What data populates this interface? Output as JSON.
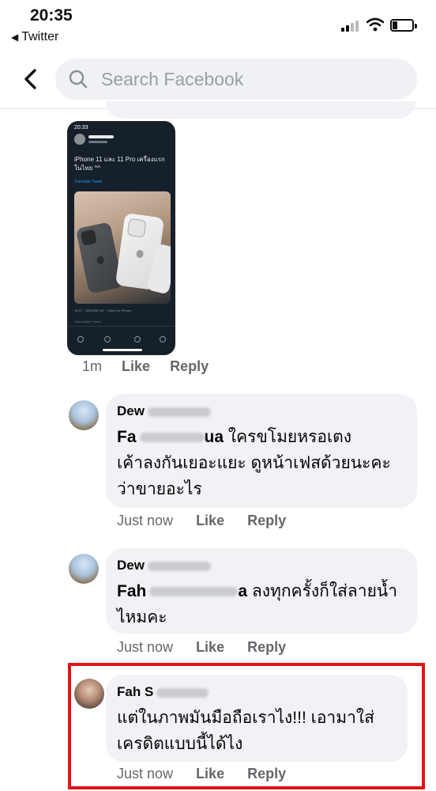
{
  "status_bar": {
    "time": "20:35",
    "back_app": "Twitter"
  },
  "header": {
    "search_placeholder": "Search Facebook"
  },
  "attachment": {
    "time": "20:33",
    "tweet_text": "iPhone 11 และ 11 Pro เครื่องแรกในไทย ^^",
    "translate": "Translate Tweet",
    "meta": "15:47 · 20/9/2562 BE · Twitter for iPhone",
    "reply_hint": "Add another Tweet"
  },
  "attachment_actions": {
    "time": "1m",
    "like": "Like",
    "reply": "Reply"
  },
  "comments": [
    {
      "author": "Dew",
      "mention": "Fa",
      "mention_tail": "ua",
      "lines": [
        "ใครขโมยหรอเตง",
        "เค้าลงกันเยอะแยะ ดูหน้าเฟสด้วยนะคะ",
        "ว่าขายอะไร"
      ],
      "time": "Just now",
      "like": "Like",
      "reply": "Reply"
    },
    {
      "author": "Dew",
      "mention": "Fah",
      "mention_tail": "a",
      "lines": [
        "ลงทุกครั้งก็ใส่ลายน้ำ",
        "ไหมคะ"
      ],
      "time": "Just now",
      "like": "Like",
      "reply": "Reply"
    },
    {
      "author": "Fah S",
      "lines": [
        "แต่ในภาพมันมือถือเราไง!!! เอามาใส่",
        "เครดิตแบบนี้ได้ไง"
      ],
      "time": "Just now",
      "like": "Like",
      "reply": "Reply"
    }
  ],
  "colors": {
    "bubble": "#f0f2f5",
    "meta_text": "#65676b",
    "highlight_border": "#e0141b"
  }
}
